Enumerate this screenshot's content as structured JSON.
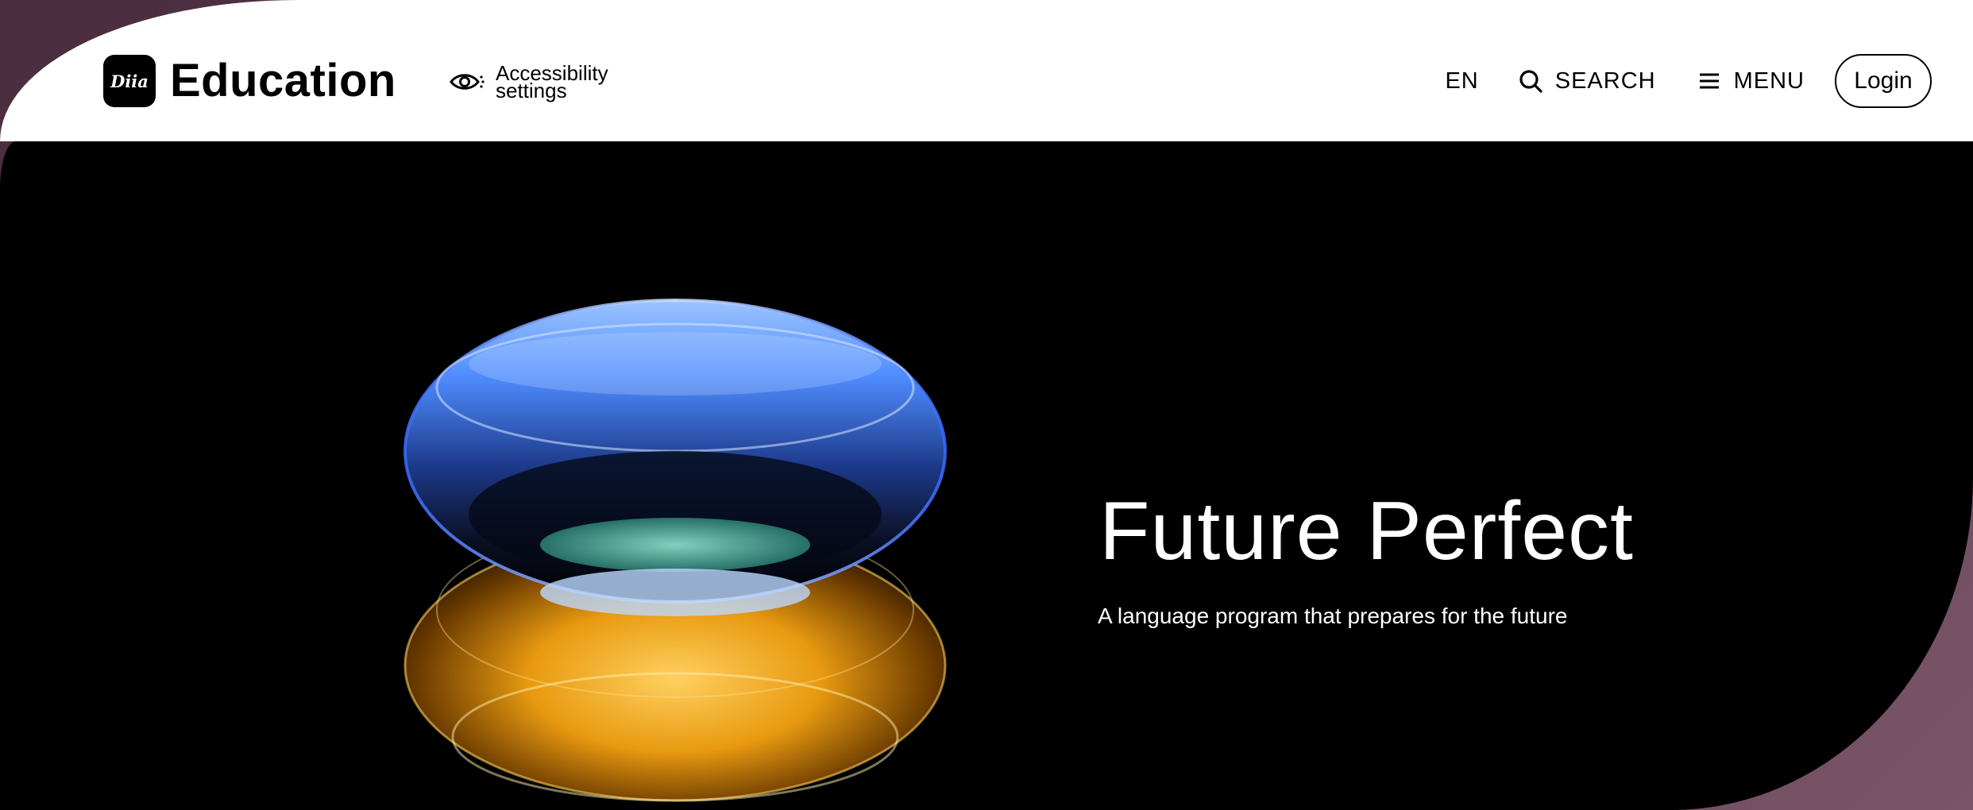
{
  "header": {
    "logo_text": "Diia",
    "brand": "Education",
    "accessibility": {
      "line1": "Accessibility",
      "line2": "settings"
    },
    "nav": {
      "language": "EN",
      "search": "SEARCH",
      "menu": "MENU",
      "login": "Login"
    }
  },
  "hero": {
    "title": "Future Perfect",
    "subtitle": "A language program that prepares for the future"
  },
  "icons": {
    "accessibility": "eye-icon",
    "search": "search-icon",
    "menu": "hamburger-menu-icon"
  },
  "colors": {
    "header_bg": "#ffffff",
    "hero_bg": "#000000",
    "frame_bg": "#5a3a4e",
    "lens_blue": "#4a8cff",
    "lens_gold": "#f0a820"
  }
}
